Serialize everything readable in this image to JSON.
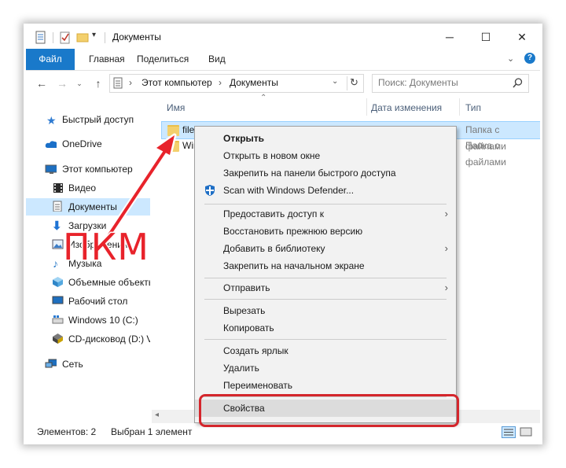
{
  "window": {
    "title": "Документы",
    "controls": {
      "minimize": "─",
      "maximize": "☐",
      "close": "✕"
    }
  },
  "ribbon": {
    "tabs": [
      "Файл",
      "Главная",
      "Поделиться",
      "Вид"
    ]
  },
  "address": {
    "path": [
      "Этот компьютер",
      "Документы"
    ],
    "search_placeholder": "Поиск: Документы"
  },
  "nav": {
    "items": [
      {
        "label": "Быстрый доступ",
        "icon": "star-icon"
      },
      {
        "label": "OneDrive",
        "icon": "cloud-icon"
      },
      {
        "label": "Этот компьютер",
        "icon": "computer-icon"
      },
      {
        "label": "Видео",
        "icon": "video-icon"
      },
      {
        "label": "Документы",
        "icon": "document-icon"
      },
      {
        "label": "Загрузки",
        "icon": "download-icon"
      },
      {
        "label": "Изображения",
        "icon": "pictures-icon"
      },
      {
        "label": "Музыка",
        "icon": "music-icon"
      },
      {
        "label": "Объемные объекты",
        "icon": "3d-objects-icon"
      },
      {
        "label": "Рабочий стол",
        "icon": "desktop-icon"
      },
      {
        "label": "Windows 10 (C:)",
        "icon": "drive-icon"
      },
      {
        "label": "CD-дисковод (D:) V",
        "icon": "cd-drive-icon"
      },
      {
        "label": "Сеть",
        "icon": "network-icon"
      }
    ]
  },
  "columns": {
    "name": "Имя",
    "date": "Дата изменения",
    "type": "Тип"
  },
  "files": [
    {
      "name": "file",
      "type": "Папка с файлами"
    },
    {
      "name": "Win",
      "type": "Папка с файлами"
    }
  ],
  "status": {
    "count": "Элементов: 2",
    "selected": "Выбран 1 элемент"
  },
  "context_menu": {
    "open": "Открыть",
    "open_new_window": "Открыть в новом окне",
    "pin_quick_access": "Закрепить на панели быстрого доступа",
    "defender": "Scan with Windows Defender...",
    "give_access": "Предоставить доступ к",
    "restore": "Восстановить прежнюю версию",
    "add_library": "Добавить в библиотеку",
    "pin_start": "Закрепить на начальном экране",
    "send_to": "Отправить",
    "cut": "Вырезать",
    "copy": "Копировать",
    "shortcut": "Создать ярлык",
    "delete": "Удалить",
    "rename": "Переименовать",
    "properties": "Свойства"
  },
  "annotation": {
    "label": "ПКМ",
    "color": "#e8232b"
  },
  "colors": {
    "accent": "#1979ca",
    "selection": "#cce8ff",
    "highlight": "#d4262c"
  }
}
